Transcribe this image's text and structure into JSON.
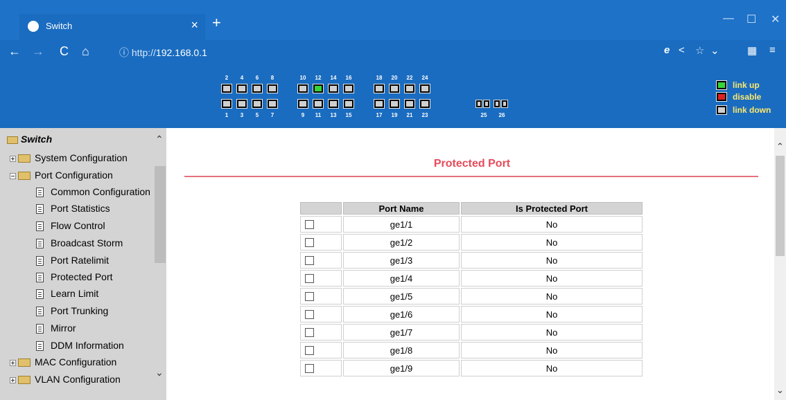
{
  "browser": {
    "tab_title": "Switch",
    "tab_close": "×",
    "new_tab": "+",
    "url_info": "ⓘ http://",
    "url_host": "192.168.0.1"
  },
  "ports": {
    "top_labels": [
      "2",
      "4",
      "6",
      "8",
      "10",
      "12",
      "14",
      "16",
      "18",
      "20",
      "22",
      "24"
    ],
    "bottom_labels": [
      "1",
      "3",
      "5",
      "7",
      "9",
      "11",
      "13",
      "15",
      "17",
      "19",
      "21",
      "23"
    ],
    "sfp_labels": [
      "25",
      "26"
    ],
    "link_up_port": "12"
  },
  "legend": {
    "link_up": "link up",
    "disable": "disable",
    "link_down": "link down"
  },
  "sidebar": {
    "root": "Switch",
    "items": [
      {
        "label": "System Configuration"
      },
      {
        "label": "Port Configuration"
      },
      {
        "label": "Common Configuration"
      },
      {
        "label": "Port Statistics"
      },
      {
        "label": "Flow Control"
      },
      {
        "label": "Broadcast Storm"
      },
      {
        "label": "Port Ratelimit"
      },
      {
        "label": "Protected Port"
      },
      {
        "label": "Learn Limit"
      },
      {
        "label": "Port Trunking"
      },
      {
        "label": "Mirror"
      },
      {
        "label": "DDM Information"
      },
      {
        "label": "MAC Configuration"
      },
      {
        "label": "VLAN Configuration"
      }
    ]
  },
  "main": {
    "title": "Protected Port",
    "table": {
      "headers": [
        "",
        "Port Name",
        "Is Protected Port"
      ],
      "rows": [
        {
          "name": "ge1/1",
          "protected": "No"
        },
        {
          "name": "ge1/2",
          "protected": "No"
        },
        {
          "name": "ge1/3",
          "protected": "No"
        },
        {
          "name": "ge1/4",
          "protected": "No"
        },
        {
          "name": "ge1/5",
          "protected": "No"
        },
        {
          "name": "ge1/6",
          "protected": "No"
        },
        {
          "name": "ge1/7",
          "protected": "No"
        },
        {
          "name": "ge1/8",
          "protected": "No"
        },
        {
          "name": "ge1/9",
          "protected": "No"
        }
      ]
    }
  },
  "colors": {
    "chrome_blue": "#1a6cc0",
    "title_red": "#e64b5a",
    "legend_yellow": "#ffe86b"
  }
}
